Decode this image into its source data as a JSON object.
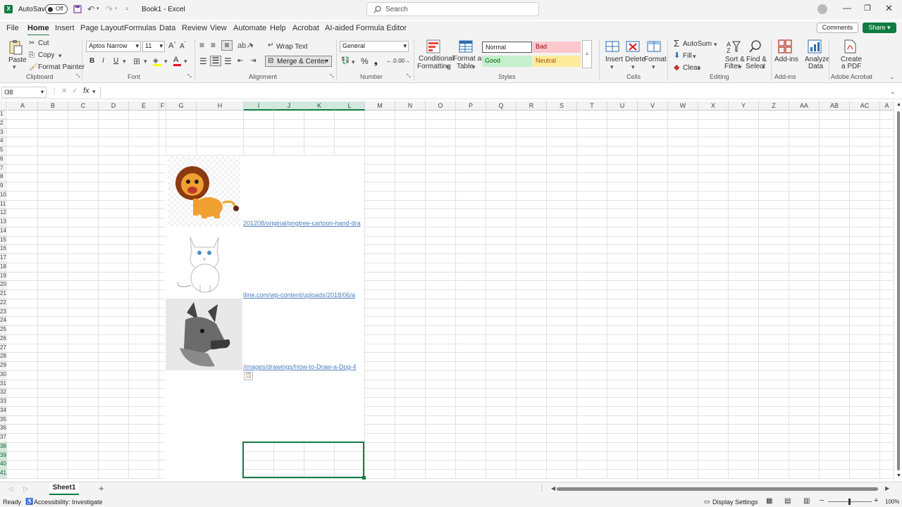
{
  "titlebar": {
    "autosave_label": "AutoSave",
    "autosave_state": "Off",
    "doc_title": "Book1 - Excel",
    "search_placeholder": "Search"
  },
  "menu": [
    "File",
    "Home",
    "Insert",
    "Page Layout",
    "Formulas",
    "Data",
    "Review",
    "View",
    "Automate",
    "Help",
    "Acrobat",
    "AI-aided Formula Editor"
  ],
  "menu_right": {
    "comments": "Comments",
    "share": "Share"
  },
  "ribbon": {
    "clipboard": {
      "paste": "Paste",
      "cut": "Cut",
      "copy": "Copy",
      "format_painter": "Format Painter",
      "group": "Clipboard"
    },
    "font": {
      "name": "Aptos Narrow",
      "size": "11",
      "group": "Font"
    },
    "alignment": {
      "wrap_text": "Wrap Text",
      "merge_center": "Merge & Center",
      "group": "Alignment"
    },
    "number": {
      "format": "General",
      "group": "Number"
    },
    "styles": {
      "conditional": "Conditional",
      "formatting": "Formatting",
      "format_as": "Format as",
      "table": "Table",
      "normal": "Normal",
      "bad": "Bad",
      "good": "Good",
      "neutral": "Neutral",
      "group": "Styles"
    },
    "cells": {
      "insert": "Insert",
      "delete": "Delete",
      "format": "Format",
      "group": "Cells"
    },
    "editing": {
      "autosum": "AutoSum",
      "fill": "Fill",
      "clear": "Clear",
      "sort_filter": "Sort &",
      "filter": "Filter",
      "find_select": "Find &",
      "select": "Select",
      "group": "Editing"
    },
    "addins": {
      "addins": "Add-ins",
      "analyze": "Analyze",
      "data": "Data",
      "group": "Add-ins"
    },
    "acrobat": {
      "create": "Create",
      "pdf": "a PDF",
      "group": "Adobe Acrobat"
    }
  },
  "formula_bar": {
    "name_box": "I38",
    "fx": "fx"
  },
  "columns": [
    "A",
    "B",
    "C",
    "D",
    "E",
    "F",
    "G",
    "H",
    "I",
    "J",
    "K",
    "L",
    "M",
    "N",
    "O",
    "P",
    "Q",
    "R",
    "S",
    "T",
    "U",
    "V",
    "W",
    "X",
    "Y",
    "Z",
    "AA",
    "AB",
    "AC",
    "A"
  ],
  "rows": [
    "1",
    "2",
    "3",
    "4",
    "5",
    "6",
    "7",
    "8",
    "9",
    "10",
    "11",
    "12",
    "13",
    "14",
    "15",
    "16",
    "17",
    "18",
    "19",
    "20",
    "21",
    "22",
    "23",
    "24",
    "25",
    "26",
    "27",
    "28",
    "29",
    "30",
    "31",
    "32",
    "33",
    "34",
    "35",
    "36",
    "37",
    "38",
    "39",
    "40",
    "41"
  ],
  "links": [
    "201208/original/pngtree-cartoon-hand-dra",
    "tline.com/wp-content/uploads/2018/06/a",
    "/images/drawings/How-to-Draw-a-Dog-4"
  ],
  "sheet": {
    "tab": "Sheet1"
  },
  "status": {
    "ready": "Ready",
    "accessibility": "Accessibility: Investigate",
    "display": "Display Settings",
    "zoom": "100%"
  }
}
